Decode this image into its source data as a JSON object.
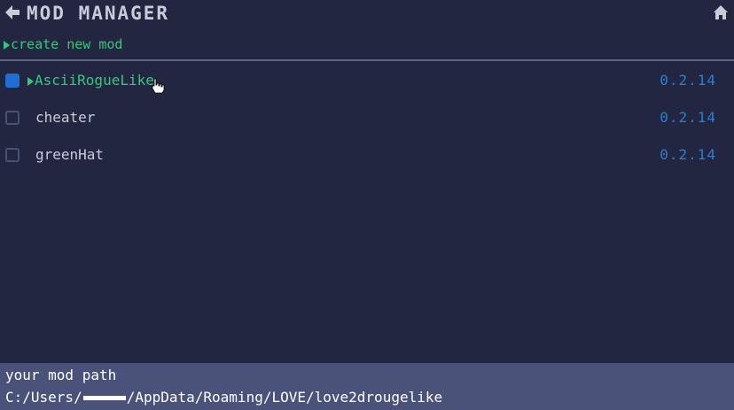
{
  "header": {
    "title": "MOD MANAGER",
    "back_icon": "arrow-left-icon",
    "home_icon": "home-icon"
  },
  "create_label": "create new mod",
  "mods": [
    {
      "name": "AsciiRogueLike",
      "version": "0.2.14",
      "checked": true,
      "selected": true
    },
    {
      "name": "cheater",
      "version": "0.2.14",
      "checked": false,
      "selected": false
    },
    {
      "name": "greenHat",
      "version": "0.2.14",
      "checked": false,
      "selected": false
    }
  ],
  "footer": {
    "label": "your mod path",
    "path_prefix": "C:/Users/",
    "path_suffix": "/AppData/Roaming/LOVE/love2drougelike"
  },
  "colors": {
    "background": "#222641",
    "accent_green": "#37c77a",
    "version_blue": "#2a7fd0",
    "footer_bg": "#4a5279"
  }
}
